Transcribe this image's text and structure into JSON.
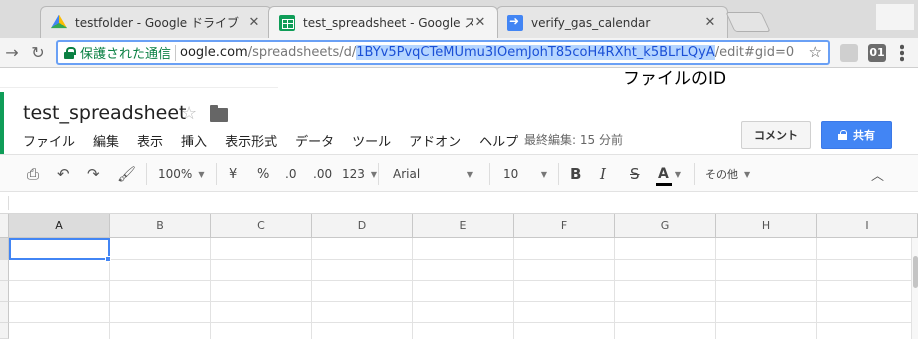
{
  "browser": {
    "tabs": [
      {
        "title": "testfolder - Google ドライブ",
        "active": false,
        "icon": "drive-icon"
      },
      {
        "title": "test_spreadsheet - Google スプ",
        "active": true,
        "icon": "sheets-icon"
      },
      {
        "title": "verify_gas_calendar",
        "active": false,
        "icon": "apps-script-icon"
      }
    ],
    "close_glyph": "✕",
    "secure_label": "保護された通信",
    "url": {
      "host": "oogle.com",
      "path_before": "/spreadsheets/d/",
      "selected_id": "1BYv5PvqCTeMUmu3IOemJohT85coH4RXht_k5BLrLQyA",
      "path_after": "/edit#gid=0"
    },
    "ext_badge": "01"
  },
  "annotation": {
    "text": "ファイルのID"
  },
  "sheet": {
    "title": "test_spreadsheet",
    "menus": [
      "ファイル",
      "編集",
      "表示",
      "挿入",
      "表示形式",
      "データ",
      "ツール",
      "アドオン",
      "ヘルプ"
    ],
    "last_edit": "最終編集: 15 分前",
    "comment_label": "コメント",
    "share_label": "共有",
    "toolbar": {
      "zoom": "100%",
      "currency": "¥",
      "percent": "%",
      "dec_less": ".0",
      "dec_more": ".00",
      "number_format": "123",
      "font": "Arial",
      "font_size": "10",
      "bold": "B",
      "italic": "I",
      "strike": "S",
      "text_color": "A",
      "more": "その他"
    },
    "columns": [
      "A",
      "B",
      "C",
      "D",
      "E",
      "F",
      "G",
      "H",
      "I"
    ],
    "selected_cell": "A1"
  },
  "colors": {
    "accent": "#4285f4",
    "sheets_green": "#0f9d58",
    "secure_green": "#0b8043"
  }
}
